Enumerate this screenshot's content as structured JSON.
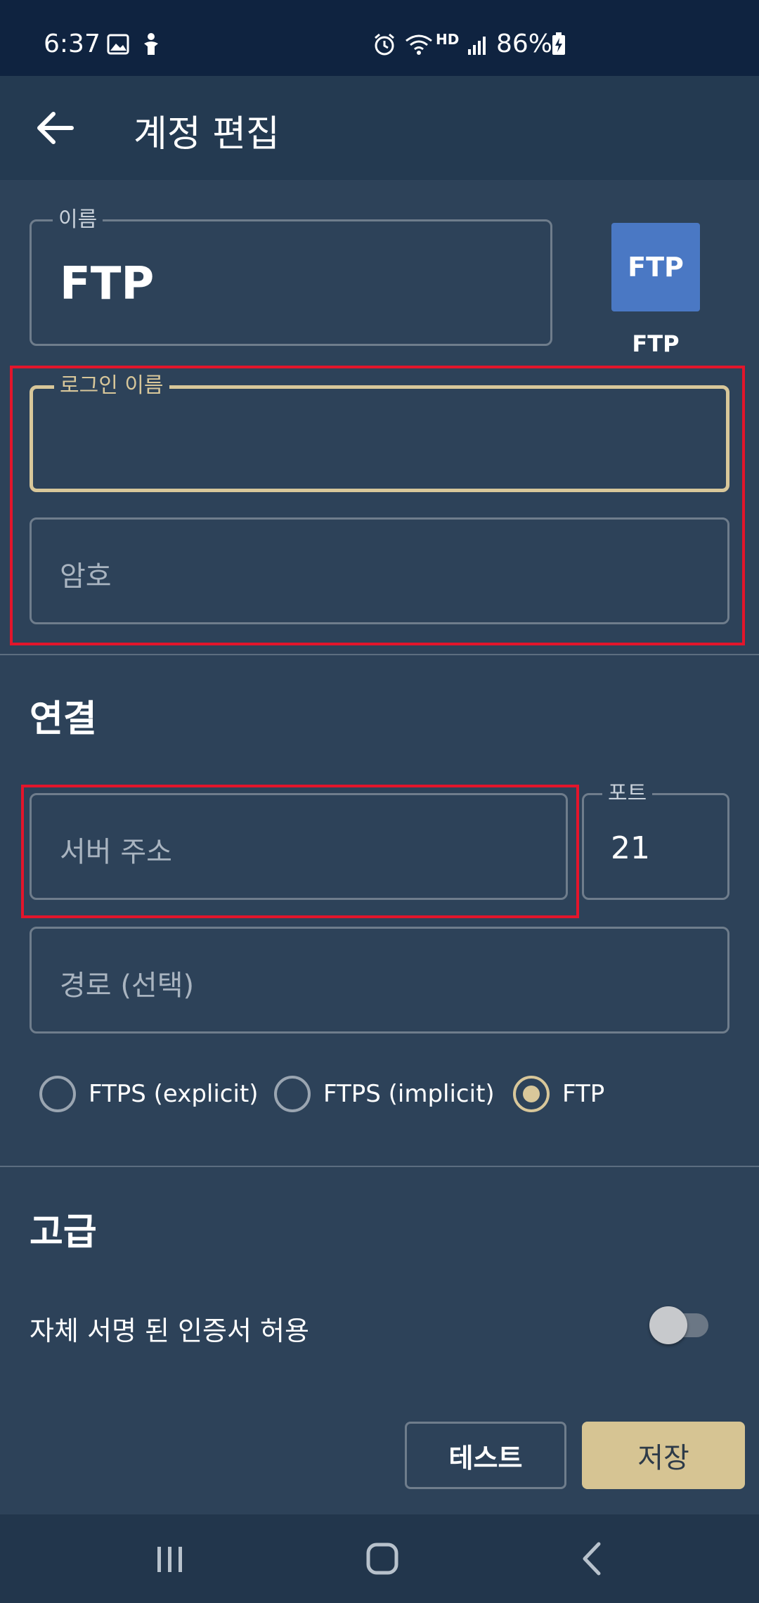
{
  "status_bar": {
    "time": "6:37",
    "battery": "86%",
    "icons": [
      "gallery-icon",
      "accessibility-icon",
      "alarm-icon",
      "wifi-icon",
      "hd-voice-icon",
      "signal-icon",
      "battery-charging-icon"
    ],
    "hd_label": "HD"
  },
  "app_bar": {
    "title": "계정 편집",
    "back_icon": "arrow-back-icon"
  },
  "account": {
    "name_label": "이름",
    "name_value": "FTP",
    "logo_text": "FTP",
    "logo_caption": "FTP",
    "login_label": "로그인 이름",
    "login_value": "",
    "password_placeholder": "암호"
  },
  "connection": {
    "title": "연결",
    "server_placeholder": "서버 주소",
    "port_label": "포트",
    "port_value": "21",
    "path_placeholder": "경로 (선택)",
    "protocols": [
      {
        "label": "FTPS (explicit)",
        "checked": false
      },
      {
        "label": "FTPS (implicit)",
        "checked": false
      },
      {
        "label": "FTP",
        "checked": true
      }
    ]
  },
  "advanced": {
    "title": "고급",
    "self_signed_label": "자체 서명 된 인증서 허용",
    "self_signed_enabled": false
  },
  "actions": {
    "test_label": "테스트",
    "save_label": "저장"
  },
  "nav_bar": {
    "icons": [
      "recent-apps-icon",
      "home-icon",
      "back-icon"
    ]
  },
  "colors": {
    "background": "#2d4259",
    "accent": "#d8c79a",
    "highlight": "#e3152b",
    "logo": "#4a78c4"
  }
}
